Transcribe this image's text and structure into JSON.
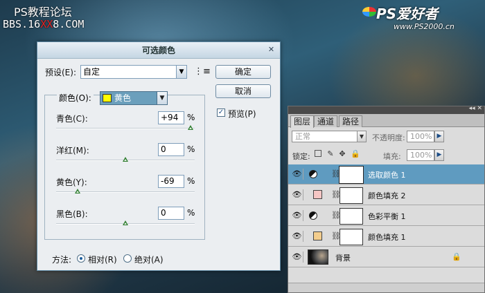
{
  "watermark": {
    "line1": "PS教程论坛",
    "line2_prefix": "BBS.16",
    "line2_red": "XX",
    "line2_suffix": "8.COM",
    "brand_name": "PS爱好者",
    "brand_url": "www.PS2000.cn"
  },
  "dialog": {
    "title": "可选颜色",
    "preset_label": "预设(E):",
    "preset_value": "自定",
    "ok_label": "确定",
    "cancel_label": "取消",
    "preview_label": "预览(P)",
    "preview_checked": true,
    "colors_label": "颜色(O):",
    "colors_value": "黄色",
    "colors_swatch": "#ffff00",
    "sliders": [
      {
        "label": "青色(C):",
        "value": "+94",
        "unit": "%",
        "position": 0.97
      },
      {
        "label": "洋红(M):",
        "value": "0",
        "unit": "%",
        "position": 0.5
      },
      {
        "label": "黄色(Y):",
        "value": "-69",
        "unit": "%",
        "position": 0.155
      },
      {
        "label": "黑色(B):",
        "value": "0",
        "unit": "%",
        "position": 0.5
      }
    ],
    "method_label": "方法:",
    "method_relative": "相对(R)",
    "method_absolute": "绝对(A)",
    "method_selected": "relative"
  },
  "layers_panel": {
    "tabs": [
      "图层",
      "通道",
      "路径"
    ],
    "active_tab": "图层",
    "blend_mode": "正常",
    "opacity_label": "不透明度:",
    "opacity_value": "100%",
    "lock_label": "锁定:",
    "fill_label": "填充:",
    "fill_value": "100%",
    "layers": [
      {
        "name": "选取颜色 1",
        "type": "adjustment",
        "selected": true
      },
      {
        "name": "颜色填充 2",
        "type": "fill",
        "color": "#f5c6c4",
        "selected": false
      },
      {
        "name": "色彩平衡 1",
        "type": "adjustment",
        "selected": false
      },
      {
        "name": "颜色填充 1",
        "type": "fill",
        "color": "#f3cd8d",
        "selected": false
      },
      {
        "name": "背景",
        "type": "background",
        "locked": true,
        "selected": false
      }
    ]
  }
}
